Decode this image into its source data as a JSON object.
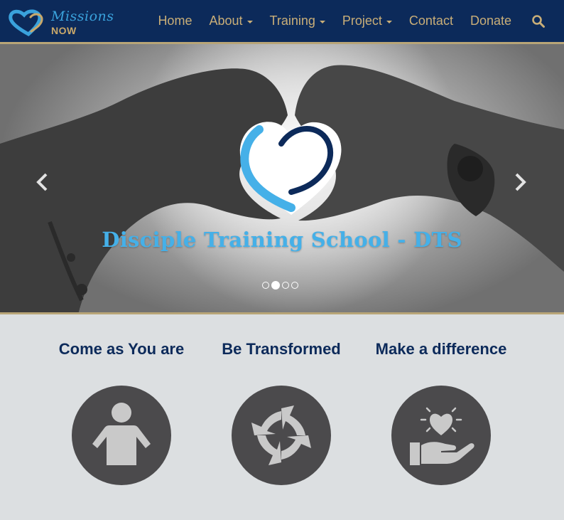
{
  "logo": {
    "top": "Missions",
    "bottom": "NOW"
  },
  "nav": {
    "items": [
      {
        "label": "Home",
        "dropdown": false
      },
      {
        "label": "About",
        "dropdown": true
      },
      {
        "label": "Training",
        "dropdown": true
      },
      {
        "label": "Project",
        "dropdown": true
      },
      {
        "label": "Contact",
        "dropdown": false
      },
      {
        "label": "Donate",
        "dropdown": false
      }
    ],
    "search_icon": "search-icon"
  },
  "hero": {
    "title": "Disciple Training School - DTS",
    "slide_count": 4,
    "active_slide": 2
  },
  "features": [
    {
      "title": "Come as You are",
      "icon": "person-icon"
    },
    {
      "title": "Be Transformed",
      "icon": "cycle-arrows-icon"
    },
    {
      "title": "Make a difference",
      "icon": "heart-in-hand-icon"
    }
  ],
  "colors": {
    "navbar_bg": "#0c2a5a",
    "nav_text": "#c9ae78",
    "accent_blue": "#45b0e8",
    "heading_navy": "#0c2a5a",
    "icon_circle": "#4b4a4c",
    "section_bg": "#dcdfe1"
  }
}
